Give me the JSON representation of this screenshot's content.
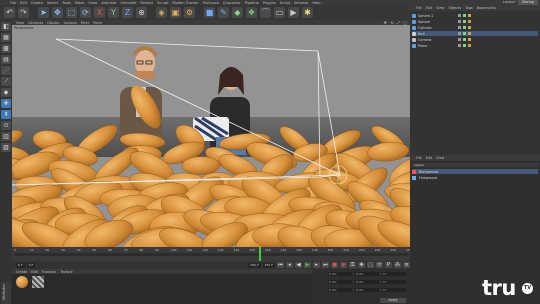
{
  "menubar": {
    "items": [
      "File",
      "Edit",
      "Create",
      "Select",
      "Tools",
      "Mesh",
      "Snap",
      "Animate",
      "Simulate",
      "Render",
      "Sculpt",
      "Motion Tracker",
      "MoGraph",
      "Character",
      "Pipeline",
      "Plugins",
      "Script",
      "Window",
      "Help"
    ],
    "layout_label": "Layout:",
    "layout_value": "Startup"
  },
  "viewport": {
    "menu": [
      "View",
      "Cameras",
      "Display",
      "Options",
      "Filter",
      "Panel"
    ],
    "label": "Perspective"
  },
  "timeline": {
    "ticks": [
      "0",
      "10",
      "20",
      "30",
      "40",
      "50",
      "60",
      "70",
      "80",
      "90",
      "100",
      "110",
      "120",
      "130",
      "140",
      "150",
      "160",
      "170",
      "180",
      "190",
      "200",
      "210",
      "220",
      "230",
      "240",
      "250"
    ],
    "current_frame_fraction": 0.625,
    "end_label": "0 F"
  },
  "transport": {
    "start_field": "0 F",
    "current_field": "0 F",
    "end_field": "250 F",
    "end_field2": "250 F"
  },
  "materials": {
    "menu": [
      "Create",
      "Edit",
      "Function",
      "Texture"
    ]
  },
  "coords": {
    "rows": [
      [
        "0 cm",
        "0 cm",
        "0 °"
      ],
      [
        "0 cm",
        "0 cm",
        "0 °"
      ],
      [
        "0 cm",
        "0 cm",
        "0 °"
      ]
    ],
    "apply_label": "Apply"
  },
  "object_manager": {
    "menu": [
      "File",
      "Edit",
      "View",
      "Objects",
      "Tags",
      "Bookmarks"
    ],
    "objects": [
      {
        "name": "Sphere.1",
        "icon_color": "#5fa0e0",
        "selected": false
      },
      {
        "name": "Sphere",
        "icon_color": "#5fa0e0",
        "selected": false
      },
      {
        "name": "Cylinder",
        "icon_color": "#5fa0e0",
        "selected": false
      },
      {
        "name": "Null",
        "icon_color": "#d0d0d0",
        "selected": true
      },
      {
        "name": "Camera",
        "icon_color": "#c0c0c0",
        "selected": false
      },
      {
        "name": "Plane",
        "icon_color": "#5fa0e0",
        "selected": false
      }
    ]
  },
  "layers": {
    "menu": [
      "File",
      "Edit",
      "View"
    ],
    "header": "Layers",
    "rows": [
      {
        "name": "Background",
        "selected": true
      },
      {
        "name": "Foreground",
        "selected": false
      }
    ]
  },
  "side_tab": "Attributes",
  "watermark": {
    "logo": "tru",
    "badge": "TV"
  },
  "colors": {
    "accent": "#3e78b8",
    "pill": "#d9963f",
    "playhead": "#49c24a"
  }
}
